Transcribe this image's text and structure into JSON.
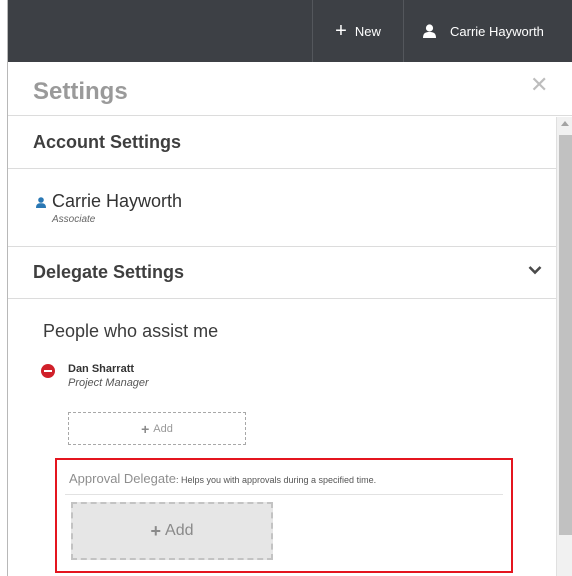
{
  "topbar": {
    "new_label": "New",
    "new_icon": "plus-icon",
    "user_name": "Carrie Hayworth",
    "user_icon": "user-icon"
  },
  "panel": {
    "title": "Settings",
    "close_icon": "close-icon"
  },
  "account_settings": {
    "heading": "Account Settings",
    "user_name": "Carrie Hayworth",
    "user_role": "Associate"
  },
  "delegate_settings": {
    "heading": "Delegate Settings",
    "people_heading": "People who assist me",
    "assistants": [
      {
        "name": "Dan Sharratt",
        "role": "Project Manager"
      }
    ],
    "add_label": "Add",
    "approval": {
      "title": "Approval Delegate",
      "description": ": Helps you with approvals during a specified time.",
      "add_label": "Add",
      "highlight_color": "#e4151f"
    }
  },
  "colors": {
    "topbar_bg": "#3d4045",
    "remove_red": "#d0202a",
    "user_icon_blue": "#2a78b4"
  }
}
